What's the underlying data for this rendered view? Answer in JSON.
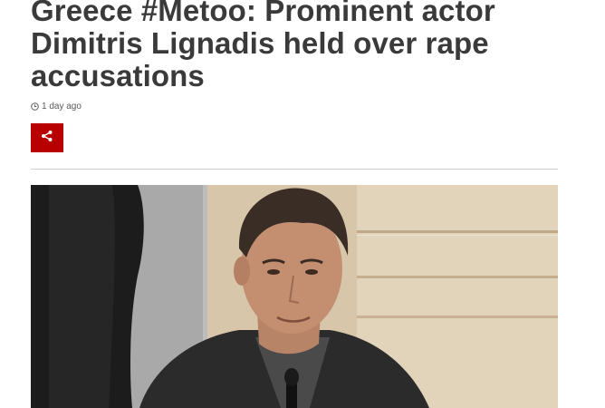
{
  "article": {
    "headline_lines": [
      "Greece #Metoo: Prominent actor",
      "Dimitris Lignadis held over rape",
      "accusations"
    ],
    "timestamp": "1 day ago",
    "timestamp_icon": "clock-icon",
    "share_icon": "share-icon",
    "share_color": "#b80000"
  },
  "image": {
    "subject": "photo"
  }
}
